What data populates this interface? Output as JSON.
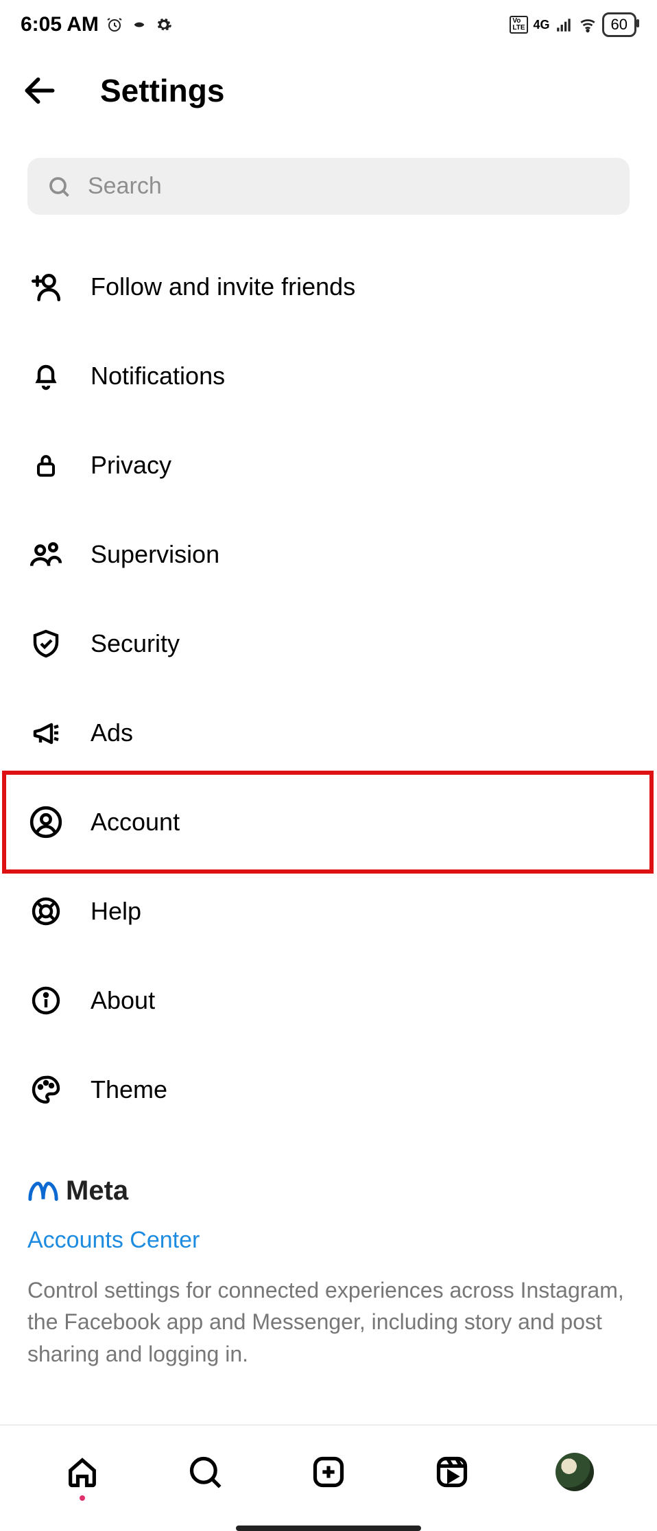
{
  "status": {
    "time": "6:05 AM",
    "network": "4G",
    "battery": "60"
  },
  "header": {
    "title": "Settings"
  },
  "search": {
    "placeholder": "Search"
  },
  "menu": {
    "items": [
      {
        "id": "follow-invite",
        "label": "Follow and invite friends",
        "icon": "add-person-icon"
      },
      {
        "id": "notifications",
        "label": "Notifications",
        "icon": "bell-icon"
      },
      {
        "id": "privacy",
        "label": "Privacy",
        "icon": "lock-icon"
      },
      {
        "id": "supervision",
        "label": "Supervision",
        "icon": "people-icon"
      },
      {
        "id": "security",
        "label": "Security",
        "icon": "shield-check-icon"
      },
      {
        "id": "ads",
        "label": "Ads",
        "icon": "megaphone-icon"
      },
      {
        "id": "account",
        "label": "Account",
        "icon": "person-circle-icon",
        "highlighted": true
      },
      {
        "id": "help",
        "label": "Help",
        "icon": "lifebuoy-icon"
      },
      {
        "id": "about",
        "label": "About",
        "icon": "info-icon"
      },
      {
        "id": "theme",
        "label": "Theme",
        "icon": "palette-icon"
      }
    ]
  },
  "meta": {
    "brand": "Meta",
    "link": "Accounts Center",
    "description": "Control settings for connected experiences across Instagram, the Facebook app and Messenger, including story and post sharing and logging in."
  },
  "highlight": {
    "color": "#d11a1a",
    "target_item_id": "account"
  }
}
